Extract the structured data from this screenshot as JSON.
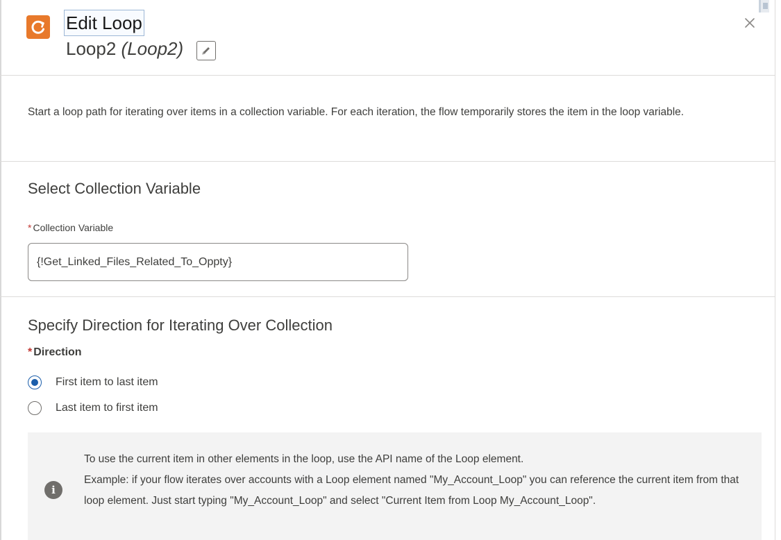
{
  "header": {
    "title": "Edit Loop",
    "element_label": "Loop2",
    "element_api_name": "(Loop2)",
    "icon": "loop-icon",
    "accent_color": "#e8792b",
    "edit_icon": "pencil-icon",
    "close_icon": "close-icon"
  },
  "description": "Start a loop path for iterating over items in a collection variable. For each iteration, the flow temporarily stores the item in the loop variable.",
  "collection_section": {
    "title": "Select Collection Variable",
    "required_marker": "*",
    "field_label": "Collection Variable",
    "field_value": "{!Get_Linked_Files_Related_To_Oppty}"
  },
  "direction_section": {
    "title": "Specify Direction for Iterating Over Collection",
    "required_marker": "*",
    "field_label": "Direction",
    "options": [
      {
        "label": "First item to last item",
        "selected": true
      },
      {
        "label": "Last item to first item",
        "selected": false
      }
    ]
  },
  "info": {
    "icon": "info-icon",
    "icon_glyph": "i",
    "line1": "To use the current item in other elements in the loop, use the API name of the Loop element.",
    "line2": "Example: if your flow iterates over accounts with a Loop element named \"My_Account_Loop\" you can reference the current item from that loop element. Just start typing \"My_Account_Loop\" and select \"Current Item from Loop My_Account_Loop\"."
  }
}
